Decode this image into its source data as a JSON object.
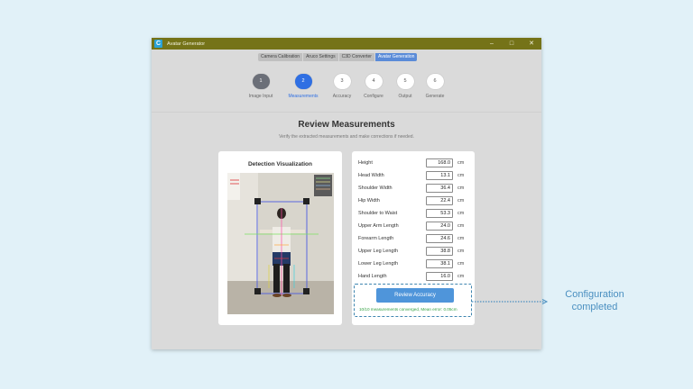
{
  "window": {
    "title": "Avatar Generator",
    "logo_letter": "C",
    "controls": {
      "minimize": "–",
      "maximize": "□",
      "close": "✕"
    }
  },
  "tabs": [
    {
      "label": "Camera Calibration",
      "active": false
    },
    {
      "label": "Aruco Settings",
      "active": false
    },
    {
      "label": "C3D Converter",
      "active": false
    },
    {
      "label": "Avatar Generation",
      "active": true
    }
  ],
  "steps": [
    {
      "number": "1",
      "label": "Image Input",
      "state": "done"
    },
    {
      "number": "2",
      "label": "Measurements",
      "state": "current"
    },
    {
      "number": "3",
      "label": "Accuracy",
      "state": "pending"
    },
    {
      "number": "4",
      "label": "Configure",
      "state": "pending"
    },
    {
      "number": "5",
      "label": "Output",
      "state": "pending"
    },
    {
      "number": "6",
      "label": "Generate",
      "state": "pending"
    }
  ],
  "review": {
    "title": "Review Measurements",
    "subtitle": "Verify the extracted measurements and make corrections if needed."
  },
  "visualization": {
    "title": "Detection Visualization"
  },
  "measurements": [
    {
      "label": "Height",
      "value": "168.0",
      "unit": "cm"
    },
    {
      "label": "Head Width",
      "value": "13.1",
      "unit": "cm"
    },
    {
      "label": "Shoulder Width",
      "value": "36.4",
      "unit": "cm"
    },
    {
      "label": "Hip Width",
      "value": "22.4",
      "unit": "cm"
    },
    {
      "label": "Shoulder to Waist",
      "value": "53.3",
      "unit": "cm"
    },
    {
      "label": "Upper Arm Length",
      "value": "24.0",
      "unit": "cm"
    },
    {
      "label": "Forearm Length",
      "value": "24.6",
      "unit": "cm"
    },
    {
      "label": "Upper Leg Length",
      "value": "38.8",
      "unit": "cm"
    },
    {
      "label": "Lower Leg Length",
      "value": "38.1",
      "unit": "cm"
    },
    {
      "label": "Hand Length",
      "value": "16.0",
      "unit": "cm"
    }
  ],
  "actions": {
    "review_accuracy_label": "Review Accuracy",
    "convergence_status": "10/10 measurements converged, Mean error: 0.05cm"
  },
  "annotation": {
    "callout_line1": "Configuration",
    "callout_line2": "completed"
  },
  "colors": {
    "titlebar": "#757318",
    "active_tab": "#5a8bd8",
    "current_step": "#2f6fe3",
    "done_step": "#6b6f78",
    "primary_button": "#4f95da",
    "success_text": "#2e9f3e",
    "callout": "#4a8fc0"
  }
}
